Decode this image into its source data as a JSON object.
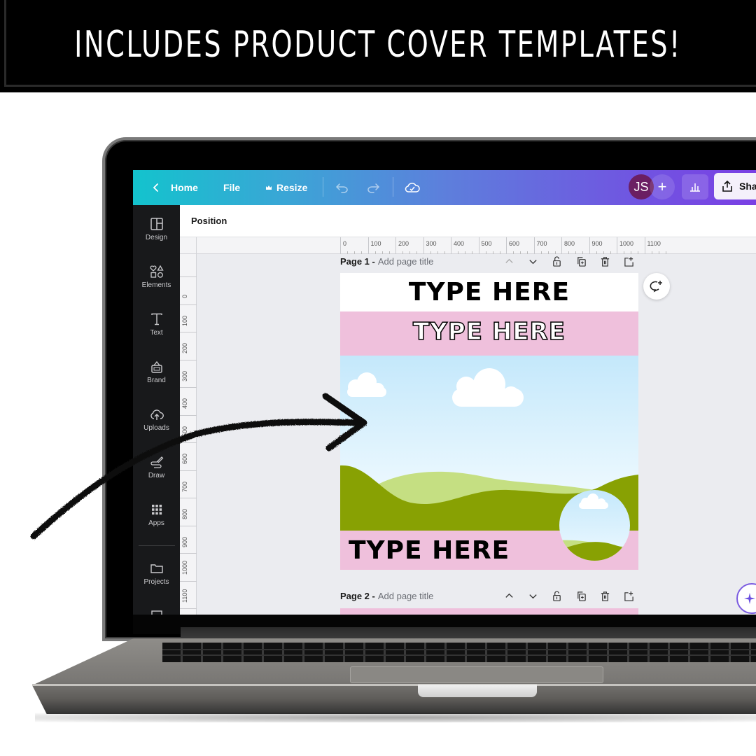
{
  "banner": {
    "headline": "INCLUDES PRODUCT COVER TEMPLATES!"
  },
  "editor": {
    "topbar": {
      "home_label": "Home",
      "file_label": "File",
      "resize_label": "Resize",
      "avatar_initials": "JS",
      "add_collaborator_label": "+",
      "share_label": "Sha"
    },
    "sidebar": {
      "items": [
        {
          "label": "Design",
          "icon": "layout-icon"
        },
        {
          "label": "Elements",
          "icon": "shapes-icon"
        },
        {
          "label": "Text",
          "icon": "text-icon"
        },
        {
          "label": "Brand",
          "icon": "brand-kit-icon"
        },
        {
          "label": "Uploads",
          "icon": "cloud-upload-icon"
        },
        {
          "label": "Draw",
          "icon": "draw-icon"
        },
        {
          "label": "Apps",
          "icon": "apps-grid-icon"
        },
        {
          "label": "Projects",
          "icon": "folder-icon"
        }
      ]
    },
    "context_bar": {
      "label": "Position"
    },
    "ruler": {
      "top_ticks": [
        "0",
        "100",
        "200",
        "300",
        "400",
        "500",
        "600",
        "700",
        "800",
        "900",
        "1000",
        "1100"
      ],
      "left_ticks": [
        "0",
        "100",
        "200",
        "300",
        "400",
        "500",
        "600",
        "700",
        "800",
        "900",
        "1000",
        "1100",
        "0"
      ]
    },
    "pages": [
      {
        "number_label": "Page 1 -",
        "title_placeholder": "Add page title",
        "content": {
          "heading_1": "TYPE HERE",
          "heading_2": "TYPE HERE",
          "heading_3": "TYPE HERE"
        },
        "colors": {
          "pink": "#efc0dc",
          "sky": "#c4e8fb",
          "grass_dark": "#88a103",
          "grass_light": "#c5df82"
        }
      },
      {
        "number_label": "Page 2 -",
        "title_placeholder": "Add page title"
      }
    ]
  },
  "colors": {
    "topbar_start": "#13c3cd",
    "topbar_end": "#7a3fe4",
    "avatar_bg": "#6b1f63",
    "sidebar_bg": "#18191b",
    "canvas_bg": "#ebecf0"
  }
}
